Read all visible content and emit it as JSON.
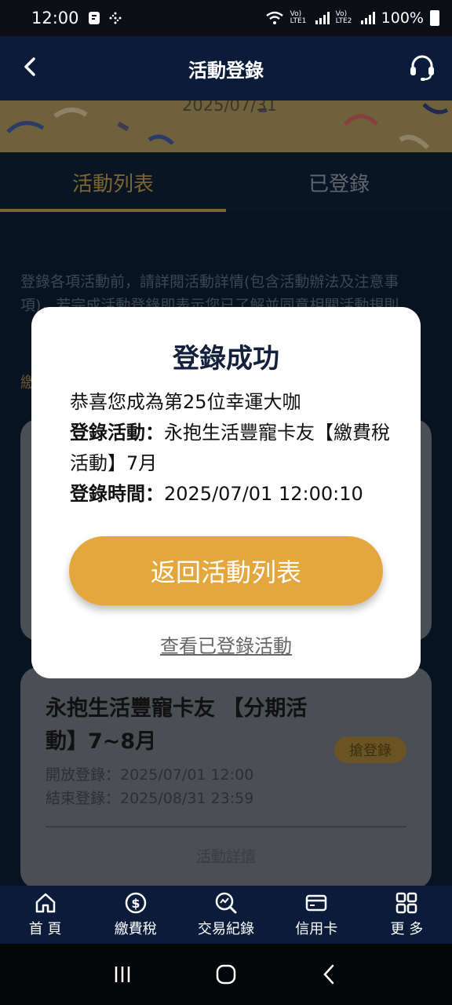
{
  "status_bar": {
    "time": "12:00",
    "network_left": "Vo) LTE1",
    "network_right": "Vo) LTE2",
    "battery": "100%"
  },
  "header": {
    "title": "活動登錄"
  },
  "banner": {
    "date": "2025/07/31"
  },
  "tabs": [
    {
      "label": "活動列表",
      "active": true
    },
    {
      "label": "已登錄",
      "active": false
    }
  ],
  "notice": {
    "text": "登錄各項活動前，請詳閱活動詳情(包含活動辦法及注意事項)，若完成活動登錄即表示您已了解並同意相關活動規則",
    "gold_fragment": "繳"
  },
  "card2": {
    "title": "永抱生活豐寵卡友 【分期活動】7~8月",
    "open_label": "開放登錄：2025/07/01 12:00",
    "close_label": "結束登錄：2025/08/31 23:59",
    "grab_button": "搶登錄",
    "detail_link": "活動詳情"
  },
  "modal": {
    "title": "登錄成功",
    "congrats": "恭喜您成為第25位幸運大咖",
    "activity_label": "登錄活動：",
    "activity_value": "永抱生活豐寵卡友【繳費稅活動】7月",
    "time_label": "登錄時間：",
    "time_value": "2025/07/01 12:00:10",
    "return_button": "返回活動列表",
    "view_link": "查看已登錄活動"
  },
  "bottom_nav": [
    {
      "label": "首 頁",
      "icon": "home-icon"
    },
    {
      "label": "繳費稅",
      "icon": "dollar-icon"
    },
    {
      "label": "交易紀錄",
      "icon": "chart-search-icon"
    },
    {
      "label": "信用卡",
      "icon": "credit-card-icon"
    },
    {
      "label": "更 多",
      "icon": "grid-icon"
    }
  ],
  "colors": {
    "header_bg": "#0a1c3a",
    "accent_gold": "#e3a73d",
    "modal_title": "#14213d"
  }
}
